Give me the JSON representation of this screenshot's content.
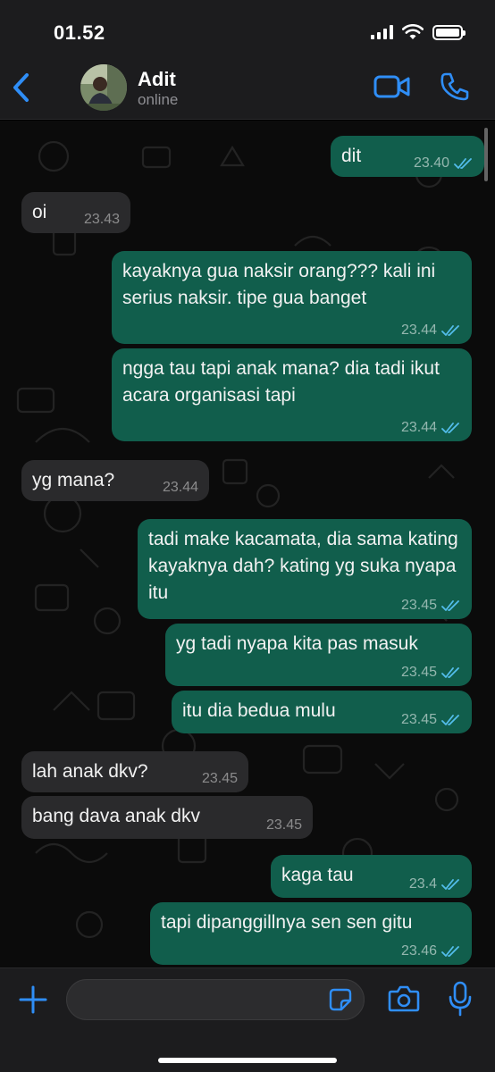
{
  "status_bar": {
    "time": "01.52"
  },
  "header": {
    "contact_name": "Adit",
    "contact_status": "online"
  },
  "messages": [
    {
      "dir": "out",
      "text": "dit",
      "time": "23.40",
      "read": true
    },
    {
      "dir": "in",
      "text": "oi",
      "time": "23.43"
    },
    {
      "dir": "out",
      "text": "kayaknya gua naksir orang??? kali ini serius naksir. tipe gua banget",
      "time": "23.44",
      "read": true
    },
    {
      "dir": "out",
      "text": "ngga tau tapi anak mana? dia tadi ikut acara organisasi tapi",
      "time": "23.44",
      "read": true
    },
    {
      "dir": "in",
      "text": "yg mana?",
      "time": "23.44"
    },
    {
      "dir": "out",
      "text": "tadi make kacamata, dia sama kating kayaknya dah? kating yg suka nyapa itu",
      "time": "23.45",
      "read": true
    },
    {
      "dir": "out",
      "text": "yg tadi nyapa kita pas masuk",
      "time": "23.45",
      "read": true
    },
    {
      "dir": "out",
      "text": "itu dia bedua mulu",
      "time": "23.45",
      "read": true
    },
    {
      "dir": "in",
      "text": "lah anak dkv?",
      "time": "23.45"
    },
    {
      "dir": "in",
      "text": "bang dava anak dkv",
      "time": "23.45"
    },
    {
      "dir": "out",
      "text": "kaga tau",
      "time": "23.4",
      "read": true
    },
    {
      "dir": "out",
      "text": "tapi dipanggillnya sen sen gitu",
      "time": "23.46",
      "read": true
    }
  ],
  "input": {
    "value": "",
    "placeholder": ""
  },
  "colors": {
    "accent": "#2f8ef7",
    "outgoing_bubble": "#115e4c",
    "incoming_bubble": "#2a2a2c",
    "read_ticks": "#53bdeb"
  },
  "icons": [
    "back-chevron-icon",
    "video-call-icon",
    "phone-icon",
    "plus-icon",
    "sticker-icon",
    "camera-icon",
    "microphone-icon",
    "chevron-down-icon",
    "double-check-icon"
  ]
}
